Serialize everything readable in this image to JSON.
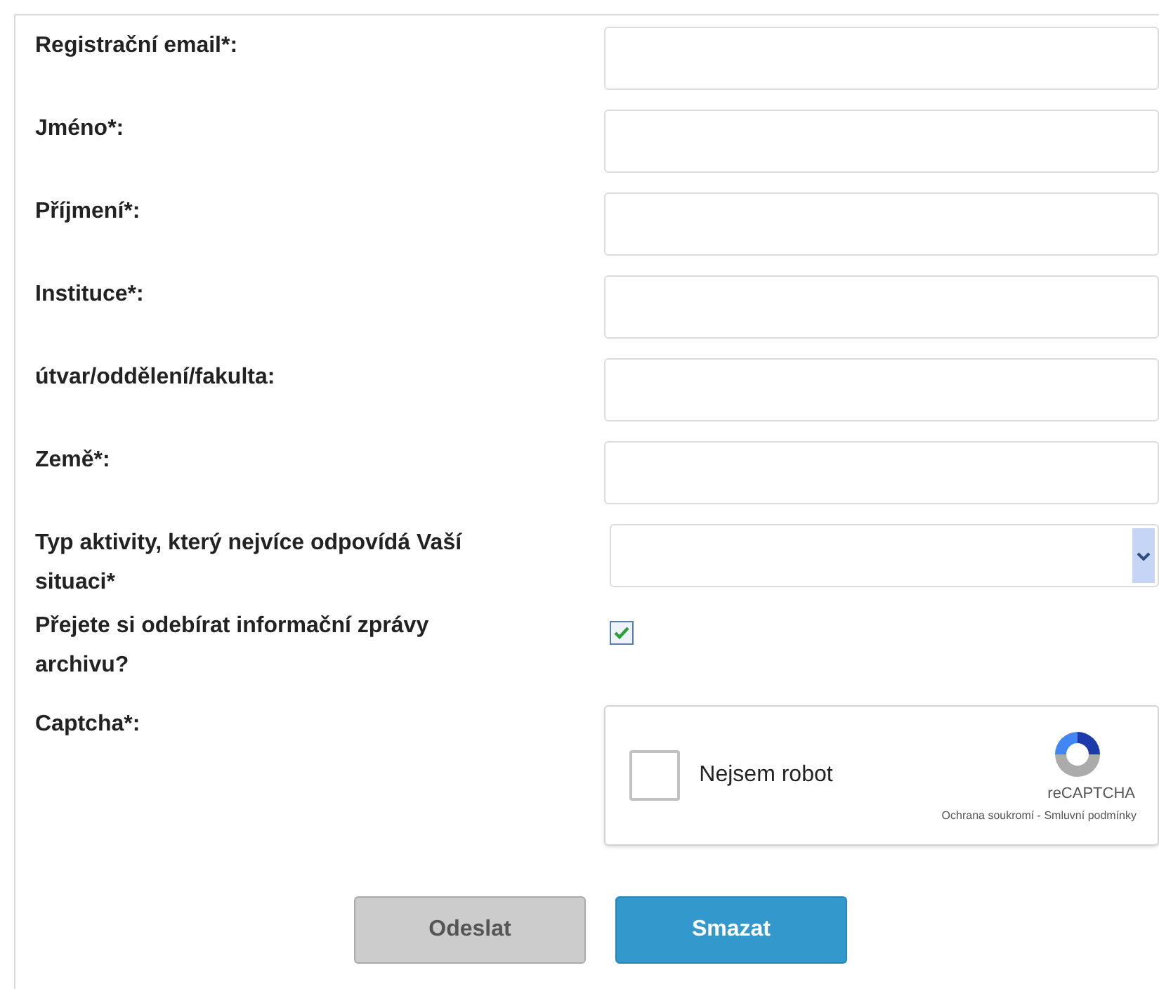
{
  "fields": [
    {
      "kind": "text",
      "label": "Registrační email*:"
    },
    {
      "kind": "text",
      "label": "Jméno*:"
    },
    {
      "kind": "text",
      "label": "Příjmení*:"
    },
    {
      "kind": "text",
      "label": "Instituce*:"
    },
    {
      "kind": "text",
      "label": "útvar/oddělení/fakulta:"
    },
    {
      "kind": "text",
      "label": "Země*:"
    },
    {
      "kind": "select",
      "label": "Typ aktivity, který nejvíce odpovídá Vaší situaci*"
    },
    {
      "kind": "checkbox",
      "label": "Přejete si odebírat informační zprávy archivu?",
      "checked": true
    },
    {
      "kind": "captcha",
      "label": "Captcha*:",
      "checked": false,
      "text": "Nejsem robot",
      "brand": "reCAPTCHA",
      "links": "Ochrana soukromí - Smluvní podmínky"
    }
  ],
  "buttons": [
    {
      "label": "Odeslat",
      "kind": "secondary"
    },
    {
      "label": "Smazat",
      "kind": "primary"
    }
  ]
}
